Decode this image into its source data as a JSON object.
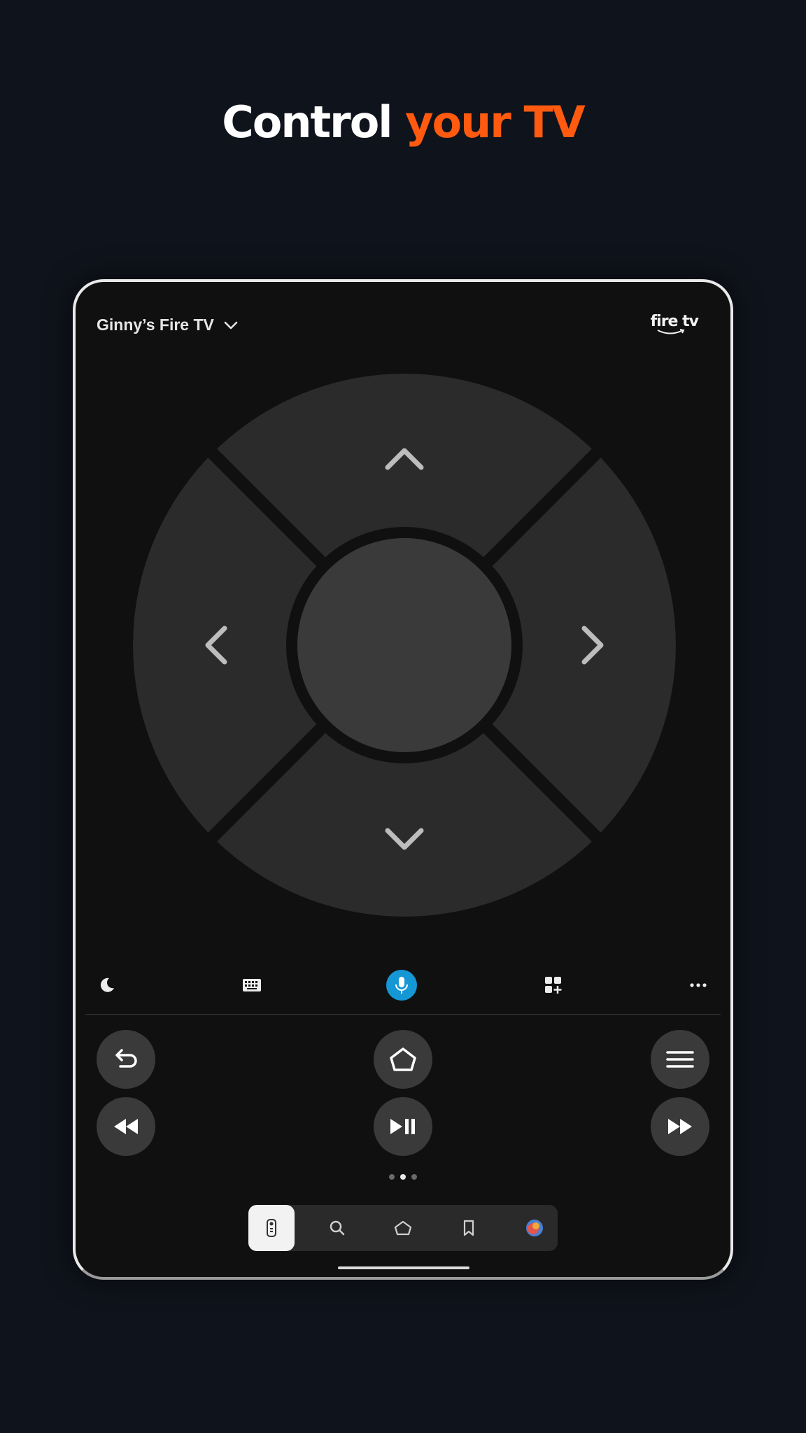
{
  "headline": {
    "part1": "Control",
    "part2": "your TV"
  },
  "device": {
    "name": "Ginny’s Fire TV",
    "logo_text": "fire tv"
  },
  "dpad": {
    "up_icon": "chevron-up-icon",
    "down_icon": "chevron-down-icon",
    "left_icon": "chevron-left-icon",
    "right_icon": "chevron-right-icon"
  },
  "toolbar": [
    "sleep-moon-icon",
    "keyboard-icon",
    "microphone-icon",
    "apps-add-icon",
    "more-dots-icon"
  ],
  "buttons": [
    "back-icon",
    "home-icon",
    "menu-icon",
    "rewind-icon",
    "play-pause-icon",
    "fast-forward-icon"
  ],
  "page_indicator": {
    "count": 3,
    "active": 2
  },
  "bottom_nav": [
    "remote-icon",
    "search-icon",
    "home-icon",
    "bookmark-icon",
    "avatar"
  ],
  "colors": {
    "accent": "#ff5a10",
    "mic": "#1597d6",
    "background": "#0f131b",
    "pad": "#2b2b2b",
    "center": "#3a3a3a"
  }
}
